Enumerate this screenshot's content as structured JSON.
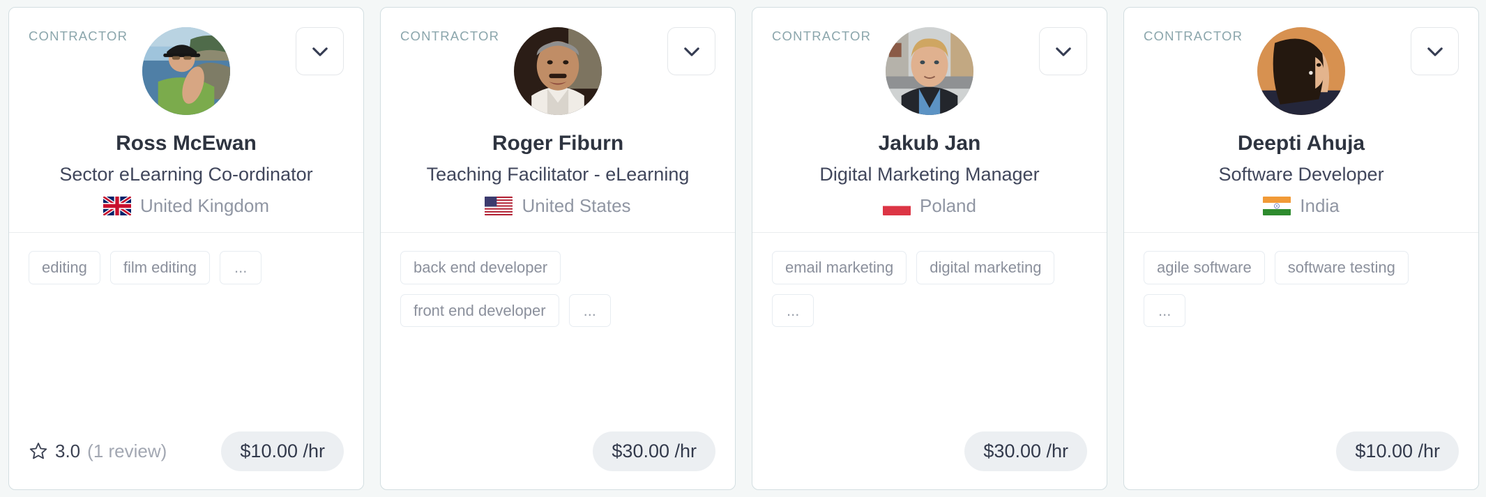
{
  "theme": {
    "page_bg": "#f4f7f7",
    "card_bg": "#ffffff",
    "card_border": "#d3dee1",
    "label_color": "#8ba6ac",
    "name_color": "#2e3440",
    "title_color": "#41475c",
    "country_color": "#9096a3",
    "tag_border": "#e7ecf1",
    "tag_text": "#8b909c",
    "price_bg": "#eceff2",
    "price_text": "#333a4c",
    "chevron_color": "#353c52"
  },
  "common": {
    "badge_label": "CONTRACTOR",
    "expand_icon": "chevron-down-icon",
    "star_icon": "star-outline-icon",
    "ellipsis_tag": "...",
    "rate_suffix": "/hr"
  },
  "cards": [
    {
      "badge": "CONTRACTOR",
      "name": "Ross McEwan",
      "title": "Sector eLearning Co-ordinator",
      "country": "United Kingdom",
      "flag": "flag-gb",
      "tags": [
        "editing",
        "film editing",
        "..."
      ],
      "rating": "3.0",
      "reviews": "(1 review)",
      "has_rating": true,
      "price": "$10.00 /hr"
    },
    {
      "badge": "CONTRACTOR",
      "name": "Roger Fiburn",
      "title": "Teaching Facilitator - eLearning",
      "country": "United States",
      "flag": "flag-us",
      "tags": [
        "back end developer",
        "front end developer",
        "..."
      ],
      "rating": "",
      "reviews": "",
      "has_rating": false,
      "price": "$30.00 /hr"
    },
    {
      "badge": "CONTRACTOR",
      "name": "Jakub Jan",
      "title": "Digital Marketing Manager",
      "country": "Poland",
      "flag": "flag-pl",
      "tags": [
        "email marketing",
        "digital marketing",
        "..."
      ],
      "rating": "",
      "reviews": "",
      "has_rating": false,
      "price": "$30.00 /hr"
    },
    {
      "badge": "CONTRACTOR",
      "name": "Deepti Ahuja",
      "title": "Software Developer",
      "country": "India",
      "flag": "flag-in",
      "tags": [
        "agile software",
        "software testing",
        "..."
      ],
      "rating": "",
      "reviews": "",
      "has_rating": false,
      "price": "$10.00 /hr"
    }
  ]
}
